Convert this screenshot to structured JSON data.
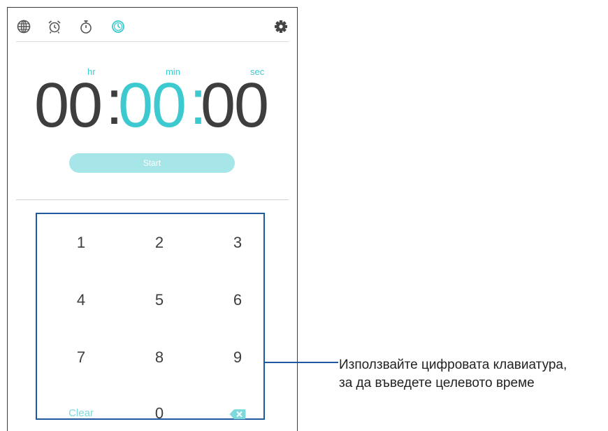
{
  "toolbar": {
    "icons": [
      "world-clock-icon",
      "alarm-icon",
      "stopwatch-icon",
      "timer-icon",
      "settings-icon"
    ],
    "accent": "#3cc9cf"
  },
  "timer": {
    "unit_hr": "hr",
    "unit_min": "min",
    "unit_sec": "sec",
    "hours": "00",
    "minutes": "00",
    "seconds": "00",
    "separator": ":",
    "start_label": "Start"
  },
  "keypad": {
    "keys": [
      "1",
      "2",
      "3",
      "4",
      "5",
      "6",
      "7",
      "8",
      "9",
      "Clear",
      "0"
    ],
    "backspace_icon": "backspace-icon"
  },
  "callout": {
    "line1": "Използвайте цифровата клавиатура,",
    "line2": "за да въведете целевото време"
  }
}
